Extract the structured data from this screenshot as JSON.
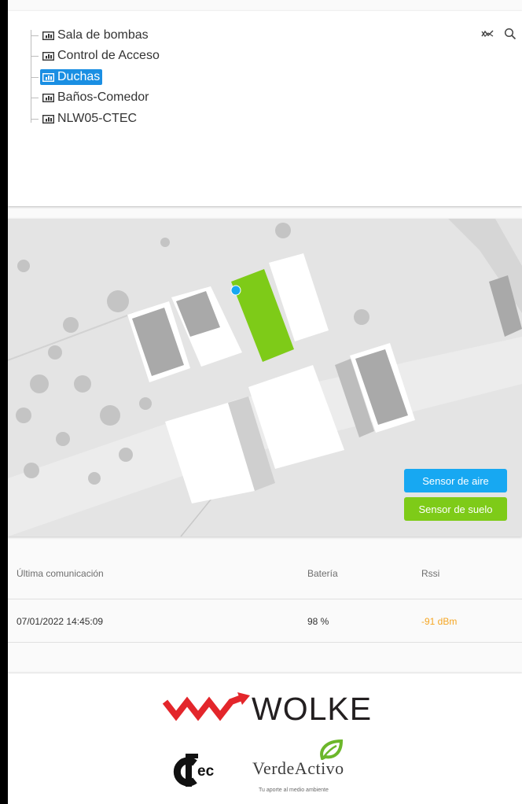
{
  "tree": {
    "items": [
      {
        "label": "Sala de bombas",
        "selected": false
      },
      {
        "label": "Control de Acceso",
        "selected": false
      },
      {
        "label": "Duchas",
        "selected": true
      },
      {
        "label": "Baños-Comedor",
        "selected": false
      },
      {
        "label": "NLW05-CTEC",
        "selected": false
      }
    ],
    "toolbar_icons": [
      "chart-trend-icon",
      "search-icon"
    ]
  },
  "map": {
    "sensor_air_label": "Sensor de aire",
    "sensor_soil_label": "Sensor de suelo",
    "colors": {
      "air": "#17a8f2",
      "soil": "#7ecb18",
      "highlight_zone": "#7ecb18",
      "marker": "#17a8f2"
    }
  },
  "table": {
    "headers": {
      "last_comm": "Última comunicación",
      "battery": "Batería",
      "rssi": "Rssi"
    },
    "row": {
      "last_comm": "07/01/2022 14:45:09",
      "battery": "98 %",
      "rssi": "-91 dBm"
    }
  },
  "footer": {
    "wolke": "WOLKE",
    "ctec": "ec",
    "verde_activo": "VerdeActivo",
    "verde_tagline": "Tu aporte al medio ambiente",
    "logos": [
      "wolke-logo",
      "ctec-logo",
      "verdeactivo-logo"
    ]
  }
}
